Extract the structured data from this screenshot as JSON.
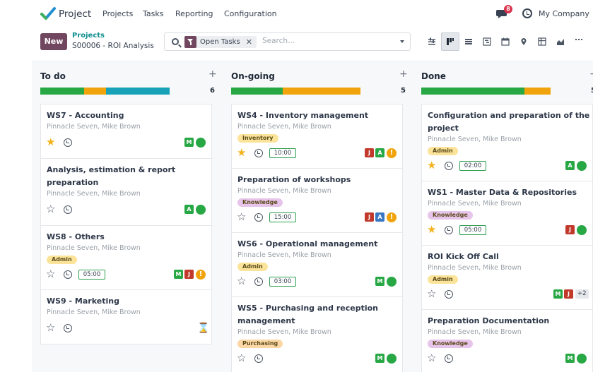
{
  "topbar": {
    "app_name": "Project",
    "menu": [
      "Projects",
      "Tasks",
      "Reporting",
      "Configuration"
    ],
    "notification_count": "8",
    "company": "My Company"
  },
  "control": {
    "new_label": "New",
    "breadcrumb_parent": "Projects",
    "breadcrumb_current": "S00006 - ROI Analysis",
    "facet_label": "Open Tasks",
    "search_placeholder": "Search...",
    "views": [
      "activity-view-icon",
      "kanban-view-icon",
      "list-view-icon",
      "gantt-view-icon",
      "calendar-view-icon",
      "map-view-icon",
      "pivot-view-icon",
      "graph-view-icon",
      "more-view-icon"
    ]
  },
  "colors": {
    "green": "#28a745",
    "orange": "#f0a30a",
    "blue": "#17a2b8",
    "accent": "#71465f"
  },
  "columns": [
    {
      "title": "To do",
      "count": "6",
      "progress": [
        {
          "color": "#28a745",
          "share": 0.34
        },
        {
          "color": "#f0a30a",
          "share": 0.17
        },
        {
          "color": "#17a2b8",
          "share": 0.49
        }
      ],
      "cards": [
        {
          "title": [
            "WS7 - Accounting"
          ],
          "customer": "Pinnacle Seven, Mike Brown",
          "tag": "",
          "starred": true,
          "time": "",
          "avatars": [
            {
              "letter": "M",
              "color": "#28a745"
            }
          ],
          "status": "green",
          "more": "",
          "hourglass": false
        },
        {
          "title": [
            "Analysis, estimation & report",
            "preparation"
          ],
          "customer": "Pinnacle Seven, Mike Brown",
          "tag": "",
          "starred": false,
          "time": "",
          "avatars": [
            {
              "letter": "A",
              "color": "#28a745"
            }
          ],
          "status": "green",
          "more": "",
          "hourglass": false
        },
        {
          "title": [
            "WS8 - Others"
          ],
          "customer": "Pinnacle Seven, Mike Brown",
          "tag": "Admin",
          "starred": false,
          "time": "05:00",
          "avatars": [
            {
              "letter": "M",
              "color": "#28a745"
            },
            {
              "letter": "J",
              "color": "#c0392b"
            }
          ],
          "status": "warn",
          "more": "",
          "hourglass": false
        },
        {
          "title": [
            "WS9 - Marketing"
          ],
          "customer": "Pinnacle Seven, Mike Brown",
          "tag": "",
          "starred": false,
          "time": "",
          "avatars": [],
          "status": "",
          "more": "",
          "hourglass": true
        }
      ]
    },
    {
      "title": "On-going",
      "count": "5",
      "progress": [
        {
          "color": "#28a745",
          "share": 0.4
        },
        {
          "color": "#f0a30a",
          "share": 0.6
        }
      ],
      "cards": [
        {
          "title": [
            "WS4 - Inventory management"
          ],
          "customer": "Pinnacle Seven, Mike Brown",
          "tag": "Inventory",
          "starred": true,
          "time": "10:00",
          "avatars": [
            {
              "letter": "J",
              "color": "#c0392b"
            },
            {
              "letter": "A",
              "color": "#28a745"
            }
          ],
          "status": "warn",
          "more": "",
          "hourglass": false
        },
        {
          "title": [
            "Preparation of workshops"
          ],
          "customer": "Pinnacle Seven, Mike Brown",
          "tag": "Knowledge",
          "starred": false,
          "time": "15:00",
          "avatars": [
            {
              "letter": "J",
              "color": "#c0392b"
            },
            {
              "letter": "A",
              "color": "#3a78c3"
            }
          ],
          "status": "warn",
          "more": "",
          "hourglass": false
        },
        {
          "title": [
            "WS6 - Operational management"
          ],
          "customer": "Pinnacle Seven, Mike Brown",
          "tag": "Admin",
          "starred": false,
          "time": "03:00",
          "avatars": [
            {
              "letter": "M",
              "color": "#28a745"
            }
          ],
          "status": "green",
          "more": "",
          "hourglass": false
        },
        {
          "title": [
            "WS5 - Purchasing and reception",
            "management"
          ],
          "customer": "Pinnacle Seven, Mike Brown",
          "tag": "Purchasing",
          "starred": false,
          "time": "",
          "avatars": [
            {
              "letter": "M",
              "color": "#28a745"
            }
          ],
          "status": "green",
          "more": "",
          "hourglass": false
        }
      ]
    },
    {
      "title": "Done",
      "count": "5",
      "progress": [
        {
          "color": "#28a745",
          "share": 0.8
        },
        {
          "color": "#f0a30a",
          "share": 0.2
        }
      ],
      "cards": [
        {
          "title": [
            "Configuration and preparation of the",
            "project"
          ],
          "customer": "Pinnacle Seven, Mike Brown",
          "tag": "Admin",
          "starred": true,
          "time": "02:00",
          "avatars": [
            {
              "letter": "A",
              "color": "#28a745"
            }
          ],
          "status": "green",
          "more": "",
          "hourglass": false
        },
        {
          "title": [
            "WS1 - Master Data & Repositories"
          ],
          "customer": "Pinnacle Seven, Mike Brown",
          "tag": "Knowledge",
          "starred": true,
          "time": "05:00",
          "avatars": [
            {
              "letter": "J",
              "color": "#c0392b"
            }
          ],
          "status": "green",
          "more": "",
          "hourglass": false
        },
        {
          "title": [
            "ROI Kick Off Call"
          ],
          "customer": "Pinnacle Seven, Mike Brown",
          "tag": "Admin",
          "starred": false,
          "time": "",
          "avatars": [
            {
              "letter": "M",
              "color": "#28a745"
            },
            {
              "letter": "J",
              "color": "#c0392b"
            }
          ],
          "status": "",
          "more": "+2",
          "hourglass": false
        },
        {
          "title": [
            "Preparation Documentation"
          ],
          "customer": "Pinnacle Seven, Mike Brown",
          "tag": "Knowledge",
          "starred": false,
          "time": "",
          "avatars": [
            {
              "letter": "M",
              "color": "#28a745"
            }
          ],
          "status": "green",
          "more": "",
          "hourglass": false
        }
      ]
    }
  ],
  "tag_colors": {
    "Admin": "#fbe49a",
    "Inventory": "#fbe49a",
    "Purchasing": "#fbd7a6",
    "Knowledge": "#e7c4ea"
  }
}
